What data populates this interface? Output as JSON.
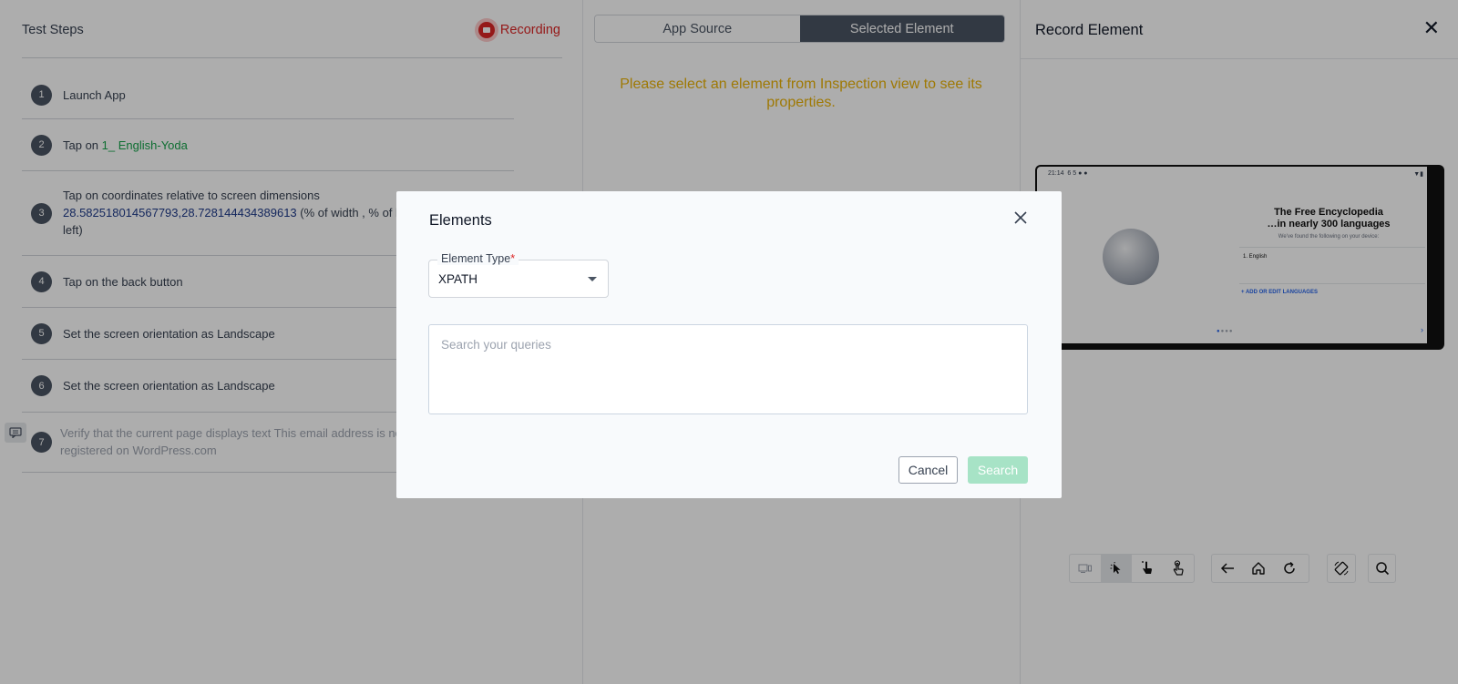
{
  "left_panel": {
    "title": "Test Steps",
    "recording_label": "Recording",
    "steps": [
      {
        "number": "1",
        "text": "Launch App"
      },
      {
        "number": "2",
        "prefix": "Tap on ",
        "link": "1_ English-Yoda"
      },
      {
        "number": "3",
        "line1": "Tap on coordinates relative to screen dimensions",
        "coords": "28.582518014567793,28.728144434389613",
        "line2_tail": " (% of width , % of h",
        "line3": "left)"
      },
      {
        "number": "4",
        "text": "Tap on the back button"
      },
      {
        "number": "5",
        "text": "Set the screen orientation as Landscape"
      },
      {
        "number": "6",
        "text": "Set the screen orientation as Landscape"
      },
      {
        "number": "7",
        "line1": "Verify that the current page displays text This email address is no",
        "line2": "registered on WordPress.com"
      }
    ]
  },
  "middle_panel": {
    "tabs": [
      {
        "label": "App Source",
        "active": false
      },
      {
        "label": "Selected Element",
        "active": true
      }
    ],
    "notice": "Please select an element from Inspection view to see its properties."
  },
  "right_panel": {
    "title": "Record Element",
    "close_icon": "close-icon",
    "device_screen": {
      "status_time": "21:14",
      "status_icons": "6 5 ● ●",
      "status_right": "▼▮",
      "title_line1": "The Free Encyclopedia",
      "title_line2": "…in nearly 300 languages",
      "subtitle": "We've found the following on your device:",
      "language_item": "1.   English",
      "add_languages": "+    ADD OR EDIT LANGUAGES",
      "next": "›"
    },
    "toolbar_icons": [
      "device-icon",
      "pointer-icon",
      "tap-icon",
      "swipe-icon",
      "back-arrow-icon",
      "home-icon",
      "refresh-icon",
      "rotate-icon",
      "search-icon"
    ]
  },
  "modal": {
    "title": "Elements",
    "element_type_label": "Element Type",
    "required_mark": "*",
    "element_type_value": "XPATH",
    "query_placeholder": "Search your queries",
    "cancel_label": "Cancel",
    "search_label": "Search"
  },
  "colors": {
    "recording": "#dc2626",
    "notice": "#eab308",
    "link": "#16a34a",
    "search_button": "#a7e3c6",
    "active_tab": "#4b5563"
  }
}
